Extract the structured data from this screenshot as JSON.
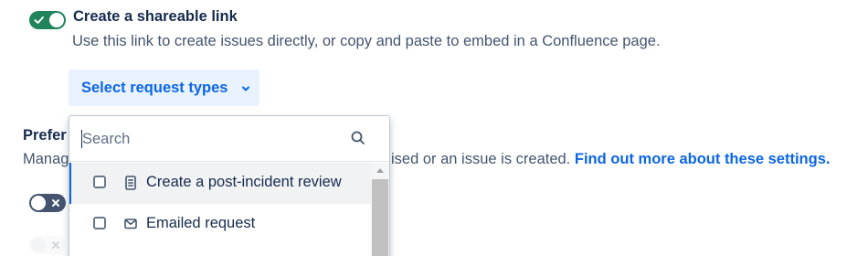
{
  "shareable_link": {
    "enabled": true,
    "title": "Create a shareable link",
    "description": "Use this link to create issues directly, or copy and paste to embed in a Confluence page."
  },
  "select_button": {
    "label": "Select request types",
    "icon": "chevron-down-icon"
  },
  "preferences": {
    "title_visible": "Prefer",
    "desc_visible_start": "Manag",
    "desc_visible_end": "ised or an issue is created.",
    "link_label": "Find out more about these settings.",
    "toggles": [
      {
        "state": false,
        "icon": "close-icon"
      },
      {
        "state": false,
        "icon": "close-icon",
        "disabled": true
      }
    ]
  },
  "dropdown": {
    "search": {
      "placeholder": "Search",
      "value": ""
    },
    "items": [
      {
        "label": "Create a post-incident review",
        "icon": "document-icon",
        "checked": false
      },
      {
        "label": "Emailed request",
        "icon": "envelope-icon",
        "checked": false
      }
    ]
  },
  "colors": {
    "toggle_on": "#1f845a",
    "toggle_off": "#44546f",
    "link": "#0c66e4",
    "button_bg": "#e9f2ff"
  }
}
